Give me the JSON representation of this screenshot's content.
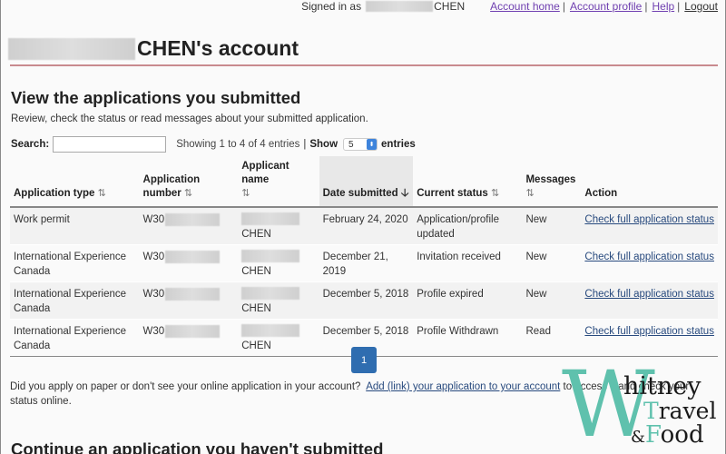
{
  "topbar": {
    "signed_in_label": "Signed in as",
    "user_surname": "CHEN",
    "links": [
      {
        "label": "Account home"
      },
      {
        "label": "Account profile"
      },
      {
        "label": "Help"
      },
      {
        "label": "Logout"
      }
    ],
    "separator": "|"
  },
  "account": {
    "title_suffix": "CHEN's account"
  },
  "submitted": {
    "heading": "View the applications you submitted",
    "intro": "Review, check the status or read messages about your submitted application.",
    "search_label": "Search:",
    "search_value": "",
    "showing_text": "Showing 1 to 4 of 4 entries",
    "show_label": "Show",
    "show_value": "5",
    "entries_label": "entries",
    "columns": [
      {
        "label": "Application type",
        "sort": "unsorted"
      },
      {
        "label": "Application number",
        "sort": "unsorted"
      },
      {
        "label": "Applicant name",
        "sort": "unsorted"
      },
      {
        "label": "Date submitted",
        "sort": "descending"
      },
      {
        "label": "Current status",
        "sort": "unsorted"
      },
      {
        "label": "Messages",
        "sort": "unsorted"
      },
      {
        "label": "Action",
        "sort": "none"
      }
    ],
    "sort_icons": {
      "unsorted": "⇅",
      "descending": "🡣"
    },
    "rows": [
      {
        "type": "Work permit",
        "number_prefix": "W30",
        "applicant": "CHEN",
        "date": "February 24, 2020",
        "status": "Application/profile updated",
        "messages": "New",
        "action": "Check full application status"
      },
      {
        "type": "International Experience Canada",
        "number_prefix": "W30",
        "applicant": "CHEN",
        "date": "December 21, 2019",
        "status": "Invitation received",
        "messages": "New",
        "action": "Check full application status"
      },
      {
        "type": "International Experience Canada",
        "number_prefix": "W30",
        "applicant": "CHEN",
        "date": "December 5, 2018",
        "status": "Profile expired",
        "messages": "New",
        "action": "Check full application status"
      },
      {
        "type": "International Experience Canada",
        "number_prefix": "W30",
        "applicant": "CHEN",
        "date": "December 5, 2018",
        "status": "Profile Withdrawn",
        "messages": "Read",
        "action": "Check full application status"
      }
    ],
    "pagination": {
      "current_page": "1"
    },
    "paper_note_before": "Did you apply on paper or don't see your online application in your account?",
    "paper_note_link": "Add (link) your application to your account",
    "paper_note_after": "to access it and check your status online."
  },
  "unsubmitted": {
    "heading": "Continue an application you haven't submitted"
  },
  "watermark": {
    "initial": "W",
    "line1": "hitney",
    "line2_initial": "T",
    "line2": "ravel",
    "line3_amp": "&",
    "line3_initial": "F",
    "line3": "ood"
  },
  "colors": {
    "primary_button": "#2f6db0",
    "visited_link": "#7040b0",
    "link": "#284a7e",
    "title_rule": "#c98a8e",
    "watermark_accent": "#5fc1ad"
  }
}
